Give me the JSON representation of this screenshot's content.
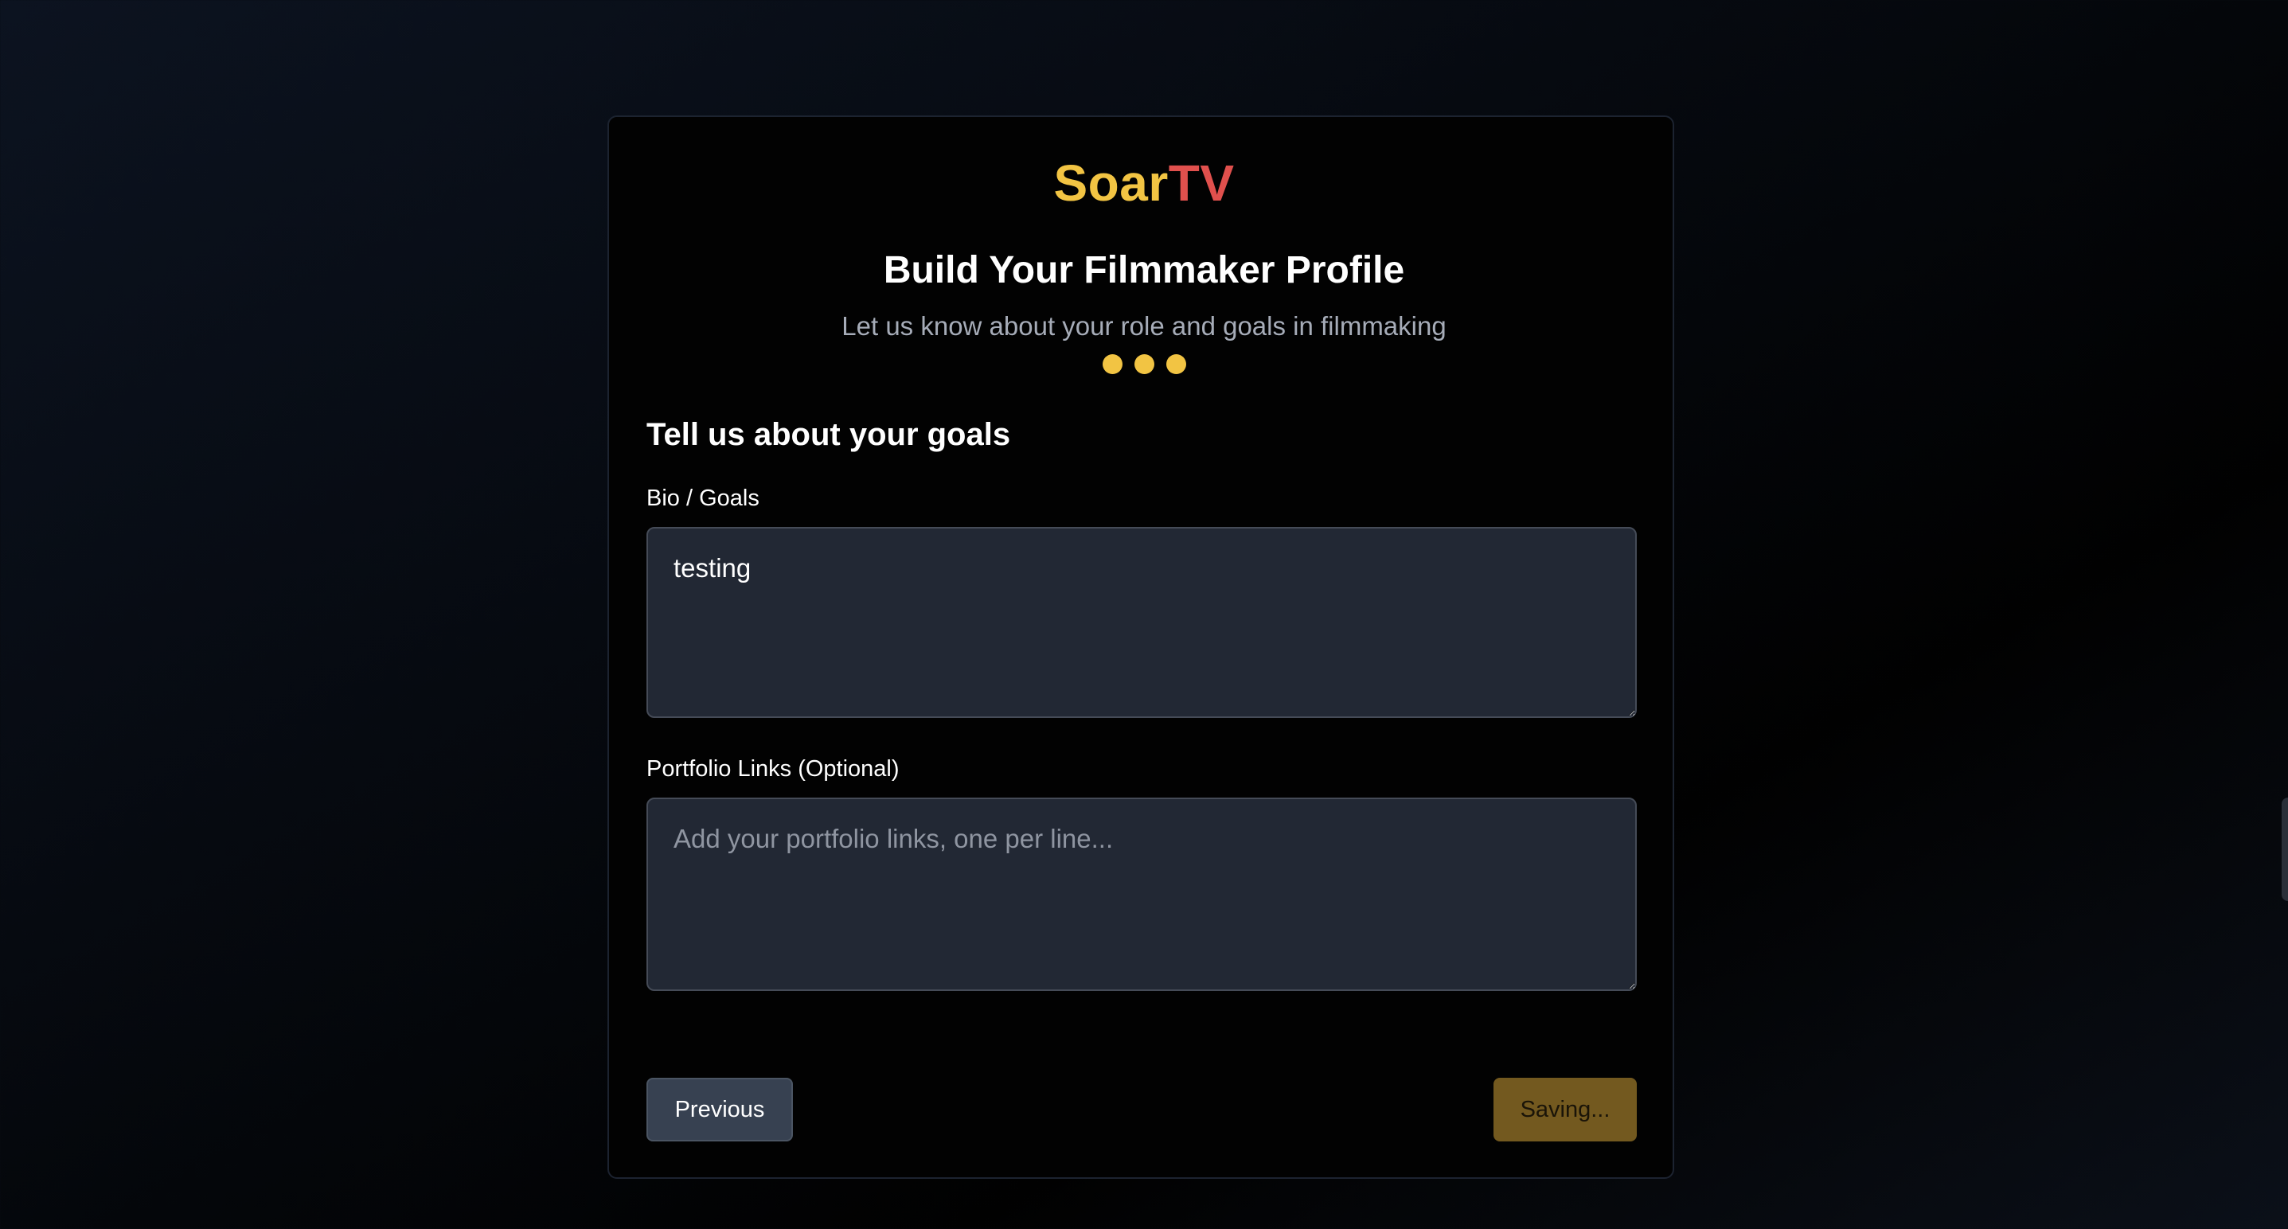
{
  "brand": {
    "part1": "Soar",
    "part2": "TV"
  },
  "header": {
    "title": "Build Your Filmmaker Profile",
    "subtitle": "Let us know about your role and goals in filmmaking"
  },
  "progress": {
    "steps_total": 3,
    "steps_completed": 3
  },
  "section": {
    "heading": "Tell us about your goals"
  },
  "fields": {
    "bio": {
      "label": "Bio / Goals",
      "value": "testing",
      "placeholder": ""
    },
    "portfolio": {
      "label": "Portfolio Links (Optional)",
      "value": "",
      "placeholder": "Add your portfolio links, one per line..."
    }
  },
  "buttons": {
    "previous": "Previous",
    "save": "Saving..."
  },
  "colors": {
    "accent": "#f2c443",
    "brand_secondary": "#e0504d",
    "card_background": "#020202",
    "input_background": "#222834",
    "save_button_disabled": "#73591f"
  }
}
